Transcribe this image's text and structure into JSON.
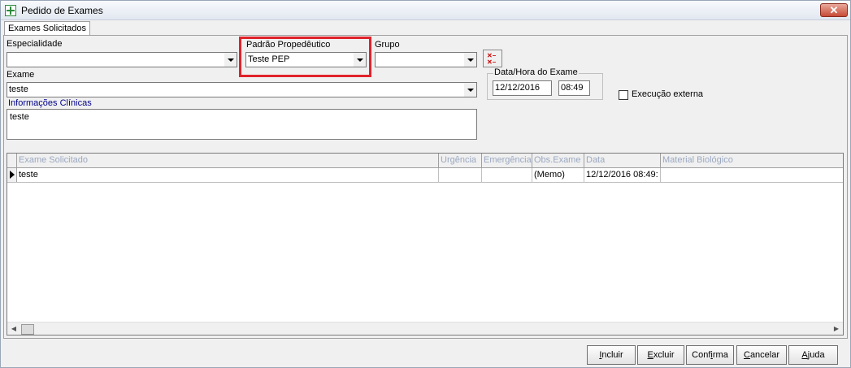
{
  "window": {
    "title": "Pedido de Exames",
    "close_label": "✕"
  },
  "tab": {
    "label": "Exames Solicitados"
  },
  "form": {
    "especialidade": {
      "label": "Especialidade",
      "value": ""
    },
    "padrao": {
      "label": "Padrão Propedêutico",
      "value": "Teste PEP"
    },
    "grupo": {
      "label": "Grupo",
      "value": ""
    },
    "exame": {
      "label": "Exame",
      "value": "teste"
    },
    "informacoes": {
      "label": "Informações Clínicas",
      "value": "teste"
    },
    "datahora": {
      "label": "Data/Hora do Exame",
      "date": "12/12/2016",
      "time": "08:49"
    },
    "execucao_externa": {
      "label": "Execução externa",
      "checked": false
    }
  },
  "grid": {
    "columns": [
      "Exame Solicitado",
      "Urgência",
      "Emergência",
      "Obs.Exame",
      "Data",
      "Material Biológico"
    ],
    "rows": [
      {
        "exame": "teste",
        "urgencia": "",
        "emergencia": "",
        "obs": "(Memo)",
        "data": "12/12/2016 08:49:",
        "material": ""
      }
    ]
  },
  "buttons": {
    "incluir": {
      "first": "I",
      "rest": "ncluir"
    },
    "excluir": {
      "first": "E",
      "rest": "xcluir"
    },
    "confirma": {
      "pre": "Conf",
      "u": "i",
      "post": "rma"
    },
    "cancelar": {
      "first": "C",
      "rest": "ancelar"
    },
    "ajuda": {
      "first": "A",
      "rest": "juda"
    }
  },
  "colors": {
    "highlight": "#e0222a",
    "header_text": "#9aa8c0",
    "label_blue": "#00008b"
  }
}
